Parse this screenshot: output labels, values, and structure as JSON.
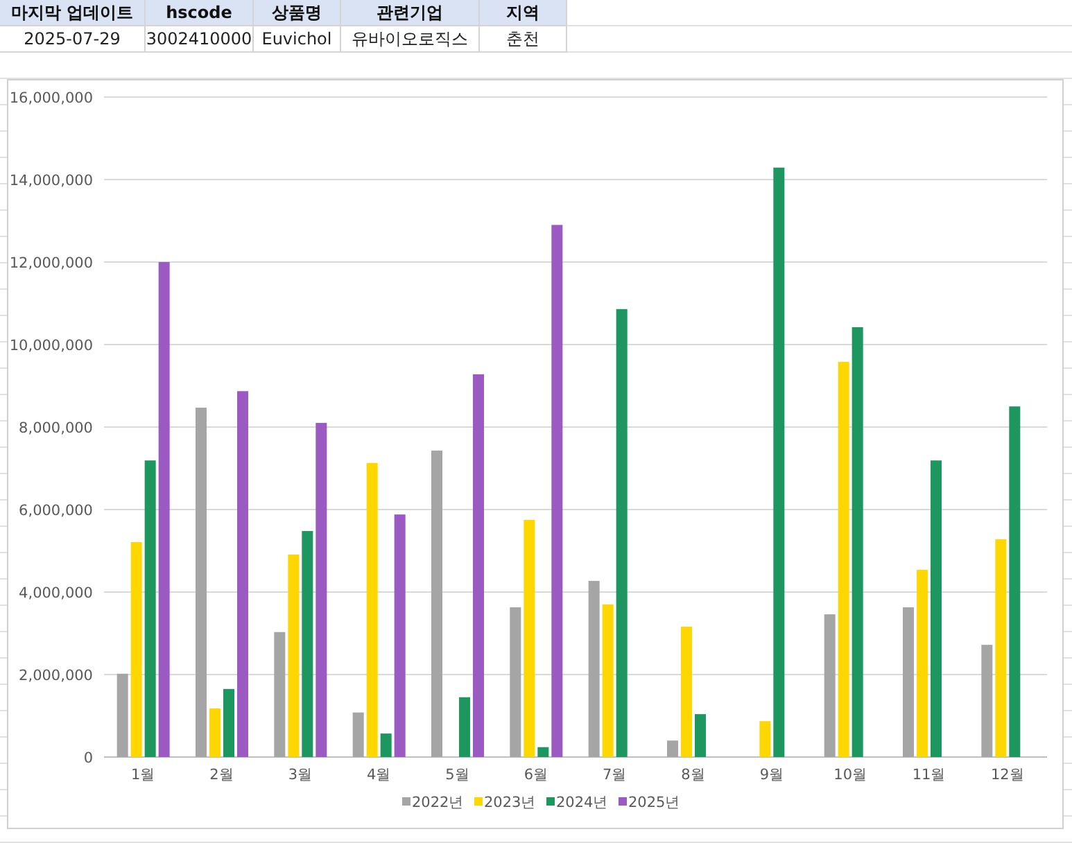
{
  "sheet": {
    "columns": [
      "마지막 업데이트",
      "hscode",
      "상품명",
      "관련기업",
      "지역"
    ],
    "rows": [
      [
        "2025-07-29",
        "3002410000",
        "Euvichol",
        "유바이오로직스",
        "춘천"
      ]
    ]
  },
  "chart": {
    "chart_data": {
      "type": "bar",
      "categories": [
        "1월",
        "2월",
        "3월",
        "4월",
        "5월",
        "6월",
        "7월",
        "8월",
        "9월",
        "10월",
        "11월",
        "12월"
      ],
      "series": [
        {
          "name": "2022년",
          "color": "#a5a5a5",
          "values": [
            2020000,
            8470000,
            3030000,
            1080000,
            7430000,
            3630000,
            4270000,
            400000,
            null,
            3460000,
            3630000,
            2720000
          ]
        },
        {
          "name": "2023년",
          "color": "#ffd700",
          "values": [
            5210000,
            1180000,
            4910000,
            7130000,
            null,
            5750000,
            3700000,
            3160000,
            870000,
            9580000,
            4540000,
            5280000
          ]
        },
        {
          "name": "2024년",
          "color": "#1e9660",
          "values": [
            7190000,
            1650000,
            5480000,
            570000,
            1450000,
            240000,
            10860000,
            1040000,
            14290000,
            10420000,
            7190000,
            8500000
          ]
        },
        {
          "name": "2025년",
          "color": "#9b59c2",
          "values": [
            12000000,
            8870000,
            8100000,
            5880000,
            9280000,
            12900000,
            null,
            null,
            null,
            null,
            null,
            null
          ]
        }
      ],
      "ylim": [
        0,
        16000000
      ],
      "grid": true,
      "legend": true,
      "yticks": [
        {
          "value": 0,
          "label": "0"
        },
        {
          "value": 2000000,
          "label": "2,000,000"
        },
        {
          "value": 4000000,
          "label": "4,000,000"
        },
        {
          "value": 6000000,
          "label": "6,000,000"
        },
        {
          "value": 8000000,
          "label": "8,000,000"
        },
        {
          "value": 10000000,
          "label": "10,000,000"
        },
        {
          "value": 12000000,
          "label": "12,000,000"
        },
        {
          "value": 14000000,
          "label": "14,000,000"
        },
        {
          "value": 16000000,
          "label": "16,000,000"
        }
      ]
    }
  }
}
